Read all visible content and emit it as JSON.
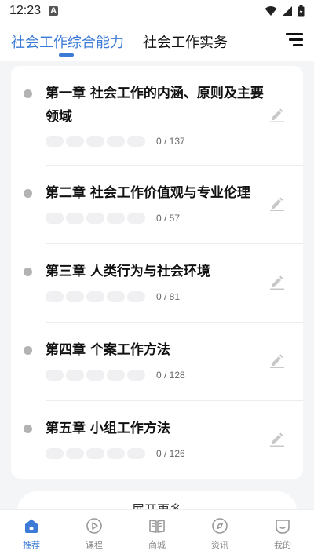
{
  "status_bar": {
    "time": "12:23"
  },
  "tabs": [
    {
      "label": "社会工作综合能力",
      "active": true
    },
    {
      "label": "社会工作实务",
      "active": false
    }
  ],
  "chapters": [
    {
      "title": "第一章 社会工作的内涵、原则及主要领域",
      "progress": "0 / 137"
    },
    {
      "title": "第二章 社会工作价值观与专业伦理",
      "progress": "0 / 57"
    },
    {
      "title": "第三章 人类行为与社会环境",
      "progress": "0 / 81"
    },
    {
      "title": "第四章 个案工作方法",
      "progress": "0 / 128"
    },
    {
      "title": "第五章 小组工作方法",
      "progress": "0 / 126"
    }
  ],
  "expand_more_label": "展开更多",
  "bottom_nav": [
    {
      "label": "推荐",
      "icon": "home-icon",
      "active": true
    },
    {
      "label": "课程",
      "icon": "play-icon",
      "active": false
    },
    {
      "label": "商城",
      "icon": "book-icon",
      "active": false
    },
    {
      "label": "资讯",
      "icon": "compass-icon",
      "active": false
    },
    {
      "label": "我的",
      "icon": "profile-icon",
      "active": false
    }
  ],
  "colors": {
    "accent": "#3b7bd6",
    "inactive": "#888888"
  }
}
